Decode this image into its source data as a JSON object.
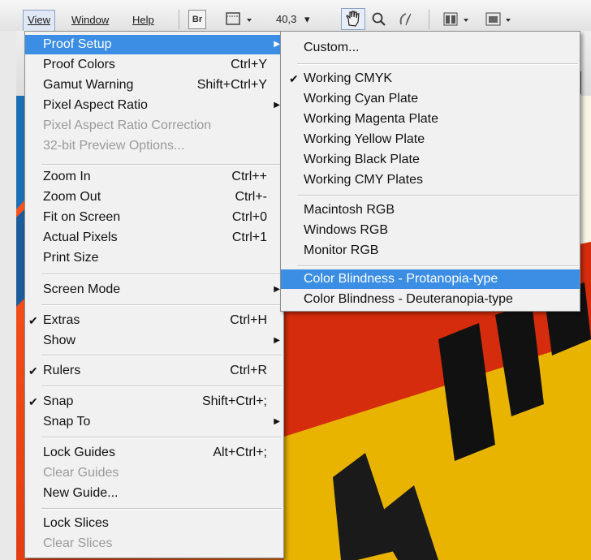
{
  "menubar": {
    "view": "View",
    "window": "Window",
    "help": "Help",
    "bridge": "Br",
    "zoom": "40,3"
  },
  "view_menu": {
    "items": [
      {
        "label": "Proof Setup",
        "shortcut": "",
        "submenu": true,
        "checked": false,
        "disabled": false,
        "highlighted": true
      },
      {
        "label": "Proof Colors",
        "shortcut": "Ctrl+Y"
      },
      {
        "label": "Gamut Warning",
        "shortcut": "Shift+Ctrl+Y"
      },
      {
        "label": "Pixel Aspect Ratio",
        "shortcut": "",
        "submenu": true
      },
      {
        "label": "Pixel Aspect Ratio Correction",
        "shortcut": "",
        "disabled": true
      },
      {
        "label": "32-bit Preview Options...",
        "shortcut": "",
        "disabled": true
      },
      {
        "label": "Zoom In",
        "shortcut": "Ctrl++"
      },
      {
        "label": "Zoom Out",
        "shortcut": "Ctrl+-"
      },
      {
        "label": "Fit on Screen",
        "shortcut": "Ctrl+0"
      },
      {
        "label": "Actual Pixels",
        "shortcut": "Ctrl+1"
      },
      {
        "label": "Print Size",
        "shortcut": ""
      },
      {
        "label": "Screen Mode",
        "shortcut": "",
        "submenu": true
      },
      {
        "label": "Extras",
        "shortcut": "Ctrl+H",
        "checked": true
      },
      {
        "label": "Show",
        "shortcut": "",
        "submenu": true
      },
      {
        "label": "Rulers",
        "shortcut": "Ctrl+R",
        "checked": true
      },
      {
        "label": "Snap",
        "shortcut": "Shift+Ctrl+;",
        "checked": true
      },
      {
        "label": "Snap To",
        "shortcut": "",
        "submenu": true
      },
      {
        "label": "Lock Guides",
        "shortcut": "Alt+Ctrl+;"
      },
      {
        "label": "Clear Guides",
        "shortcut": "",
        "disabled": true
      },
      {
        "label": "New Guide...",
        "shortcut": ""
      },
      {
        "label": "Lock Slices",
        "shortcut": ""
      },
      {
        "label": "Clear Slices",
        "shortcut": "",
        "disabled": true
      }
    ]
  },
  "proof_menu": {
    "items": [
      {
        "label": "Custom..."
      },
      {
        "label": "Working CMYK",
        "checked": true
      },
      {
        "label": "Working Cyan Plate"
      },
      {
        "label": "Working Magenta Plate"
      },
      {
        "label": "Working Yellow Plate"
      },
      {
        "label": "Working Black Plate"
      },
      {
        "label": "Working CMY Plates"
      },
      {
        "label": "Macintosh RGB"
      },
      {
        "label": "Windows RGB"
      },
      {
        "label": "Monitor RGB"
      },
      {
        "label": "Color Blindness - Protanopia-type",
        "highlighted": true
      },
      {
        "label": "Color Blindness - Deuteranopia-type"
      }
    ]
  },
  "check_mark": "✔",
  "submenu_arrow": "▶",
  "dropdown_arrow": "▾",
  "colors": {
    "highlight": "#3b8ee3",
    "menu_bg": "#f1f1f1",
    "disabled_text": "#9a9a9a"
  }
}
